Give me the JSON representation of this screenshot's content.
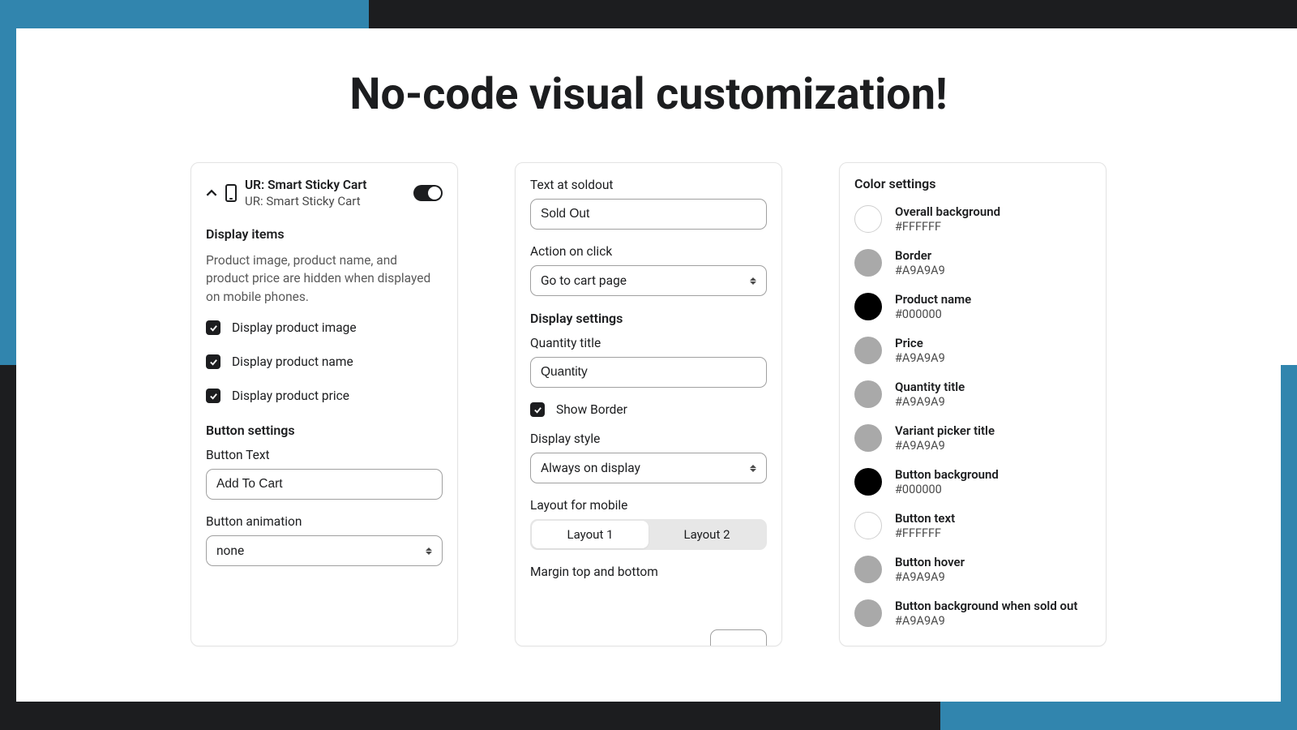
{
  "title": "No-code visual customization!",
  "card1": {
    "header": {
      "title": "UR: Smart Sticky Cart",
      "sub": "UR: Smart Sticky Cart"
    },
    "display_items_heading": "Display items",
    "description": "Product image, product name, and product price are hidden when displayed on mobile phones.",
    "checkboxes": [
      "Display product image",
      "Display product name",
      "Display product price"
    ],
    "button_settings_heading": "Button settings",
    "button_text_label": "Button Text",
    "button_text_value": "Add To Cart",
    "button_anim_label": "Button animation",
    "button_anim_value": "none"
  },
  "card2": {
    "soldout_label": "Text at soldout",
    "soldout_value": "Sold Out",
    "action_label": "Action on click",
    "action_value": "Go to cart page",
    "display_settings_heading": "Display settings",
    "qty_label": "Quantity title",
    "qty_value": "Quantity",
    "show_border_label": "Show Border",
    "display_style_label": "Display style",
    "display_style_value": "Always on display",
    "layout_mobile_label": "Layout for mobile",
    "layout1": "Layout 1",
    "layout2": "Layout 2",
    "margin_label": "Margin top and bottom"
  },
  "card3": {
    "heading": "Color settings",
    "colors": [
      {
        "name": "Overall background",
        "hex": "#FFFFFF",
        "swatch": "#FFFFFF",
        "bordered": true
      },
      {
        "name": "Border",
        "hex": "#A9A9A9",
        "swatch": "#A9A9A9"
      },
      {
        "name": "Product name",
        "hex": "#000000",
        "swatch": "#000000"
      },
      {
        "name": "Price",
        "hex": "#A9A9A9",
        "swatch": "#A9A9A9"
      },
      {
        "name": "Quantity title",
        "hex": "#A9A9A9",
        "swatch": "#A9A9A9"
      },
      {
        "name": "Variant picker title",
        "hex": "#A9A9A9",
        "swatch": "#A9A9A9"
      },
      {
        "name": "Button background",
        "hex": "#000000",
        "swatch": "#000000"
      },
      {
        "name": "Button text",
        "hex": "#FFFFFF",
        "swatch": "#FFFFFF",
        "bordered": true
      },
      {
        "name": "Button hover",
        "hex": "#A9A9A9",
        "swatch": "#A9A9A9"
      },
      {
        "name": "Button background when sold out",
        "hex": "#A9A9A9",
        "swatch": "#A9A9A9"
      }
    ]
  }
}
